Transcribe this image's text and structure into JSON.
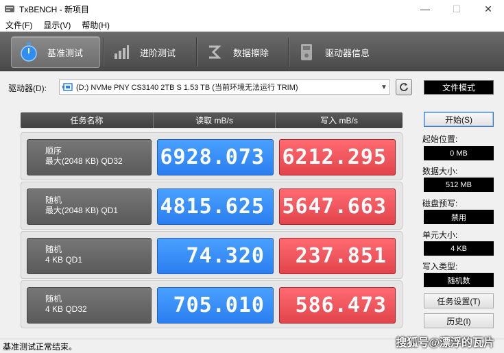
{
  "window": {
    "title": "TxBENCH - 新项目",
    "minimize": "—",
    "maximize": "☐",
    "close": "✕"
  },
  "menu": [
    "文件(F)",
    "显示(V)",
    "帮助(H)"
  ],
  "tabs": [
    {
      "label": "基准测试",
      "icon": "stopwatch-icon",
      "active": true
    },
    {
      "label": "进阶测试",
      "icon": "bar-chart-icon",
      "active": false
    },
    {
      "label": "数据擦除",
      "icon": "eraser-icon",
      "active": false
    },
    {
      "label": "驱动器信息",
      "icon": "drive-info-icon",
      "active": false
    }
  ],
  "drive": {
    "label": "驱动器(D):",
    "value": "(D:) NVMe PNY CS3140 2TB S  1.53 TB (当前环境无法运行 TRIM)"
  },
  "mode": "文件模式",
  "table": {
    "headers": [
      "任务名称",
      "读取 mB/s",
      "写入 mB/s"
    ],
    "rows": [
      {
        "name1": "顺序",
        "name2": "最大(2048 KB) QD32",
        "read": "6928.073",
        "write": "6212.295"
      },
      {
        "name1": "随机",
        "name2": "最大(2048 KB) QD1",
        "read": "4815.625",
        "write": "5647.663"
      },
      {
        "name1": "随机",
        "name2": "4 KB QD1",
        "read": "74.320",
        "write": "237.851"
      },
      {
        "name1": "随机",
        "name2": "4 KB QD32",
        "read": "705.010",
        "write": "586.473"
      }
    ]
  },
  "side": {
    "start": "开始(S)",
    "start_pos_label": "起始位置:",
    "start_pos": "0 MB",
    "data_size_label": "数据大小:",
    "data_size": "512 MB",
    "precond_label": "磁盘预写:",
    "precond": "禁用",
    "unit_size_label": "单元大小:",
    "unit_size": "4 KB",
    "write_type_label": "写入类型:",
    "write_type": "随机数",
    "task_settings": "任务设置(T)",
    "history": "历史(I)"
  },
  "status": "基准测试正常结束。",
  "watermark": "搜狐号@漂浮的瓦片",
  "colors": {
    "read": "#2a7ef0",
    "write": "#e2444c",
    "toolbar": "#555555"
  }
}
